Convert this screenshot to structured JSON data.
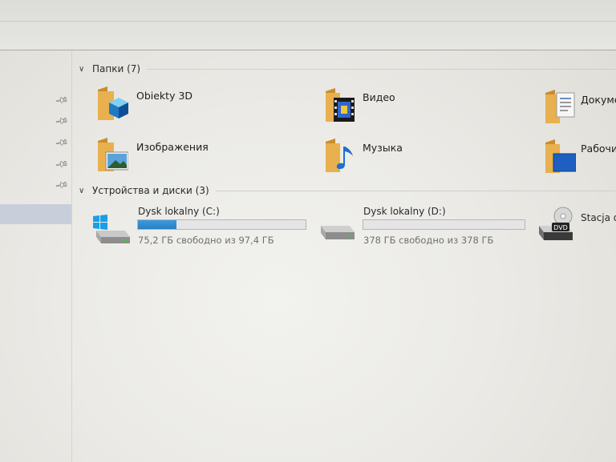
{
  "groups": {
    "folders": {
      "label": "Папки (7)",
      "items": [
        {
          "label": "Obiekty 3D",
          "icon": "3d-objects-folder-icon"
        },
        {
          "label": "Видео",
          "icon": "video-folder-icon"
        },
        {
          "label": "Докуме",
          "icon": "documents-folder-icon"
        },
        {
          "label": "Изображения",
          "icon": "pictures-folder-icon"
        },
        {
          "label": "Музыка",
          "icon": "music-folder-icon"
        },
        {
          "label": "Рабочи",
          "icon": "desktop-folder-icon"
        }
      ]
    },
    "devices": {
      "label": "Устройства и диски (3)",
      "drives": [
        {
          "name": "Dysk lokalny (C:)",
          "free": "75,2 ГБ свободно из 97,4 ГБ",
          "used_fraction": 0.228,
          "icon": "windows-drive-icon"
        },
        {
          "name": "Dysk lokalny (D:)",
          "free": "378 ГБ свободно из 378 ГБ",
          "used_fraction": 0.0,
          "icon": "hard-drive-icon"
        },
        {
          "name": "Stacja d",
          "icon": "dvd-drive-icon"
        }
      ]
    }
  },
  "colors": {
    "folder": "#e8b04f",
    "drive_fill": "#2f8bd0",
    "selection": "#c9cedb"
  }
}
